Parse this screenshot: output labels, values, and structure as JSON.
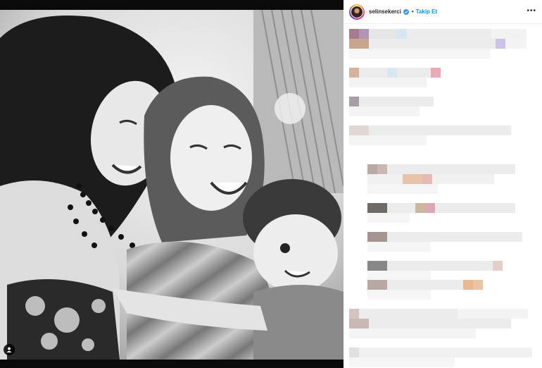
{
  "post": {
    "username": "selinsekerci",
    "separator": "•",
    "follow_label": "Takip Et",
    "more_label": "•••"
  },
  "icons": {
    "verified": "verified-badge-icon",
    "more": "more-options-icon",
    "user_tag": "user-tag-icon"
  },
  "colors": {
    "follow_blue": "#0095f6",
    "verified_blue": "#3897f0",
    "text_dark": "#262626"
  }
}
